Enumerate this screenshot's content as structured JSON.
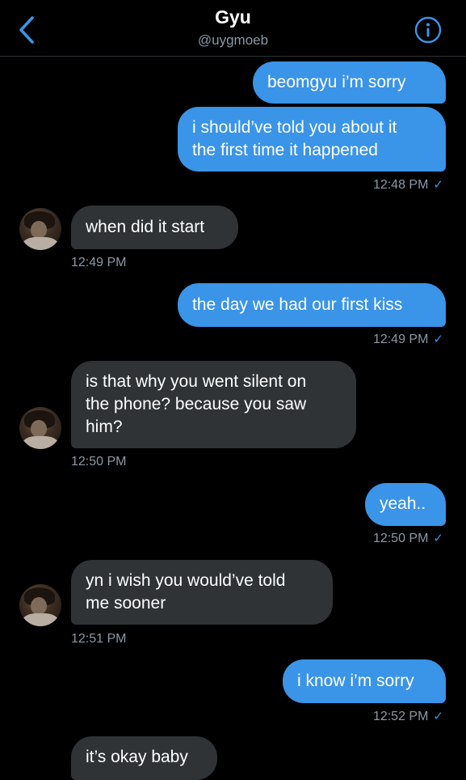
{
  "header": {
    "title": "Gyu",
    "handle": "@uygmoeb"
  },
  "messages": [
    {
      "side": "sent",
      "text": "beomgyu i’m sorry"
    },
    {
      "side": "sent",
      "text": "i should’ve told you about it\nthe first time it happened",
      "time": "12:48 PM"
    },
    {
      "side": "recv",
      "text": "when did it start",
      "time": "12:49 PM"
    },
    {
      "side": "sent",
      "text": "the day we had our first kiss",
      "time": "12:49 PM"
    },
    {
      "side": "recv",
      "text": "is that why you went silent on\nthe phone? because you saw\nhim?",
      "time": "12:50 PM"
    },
    {
      "side": "sent",
      "text": "yeah..",
      "time": "12:50 PM"
    },
    {
      "side": "recv",
      "text": "yn i wish you would’ve told\nme sooner",
      "time": "12:51 PM"
    },
    {
      "side": "sent",
      "text": "i know i’m sorry",
      "time": "12:52 PM"
    },
    {
      "side": "recv",
      "text": "it’s okay baby"
    }
  ],
  "colors": {
    "accent": "#3a94e7",
    "received_bubble": "#2f3336",
    "timestamp": "#8b98a5"
  },
  "icons": {
    "back": "chevron-left-icon",
    "info": "info-icon",
    "read": "checkmark-icon"
  }
}
